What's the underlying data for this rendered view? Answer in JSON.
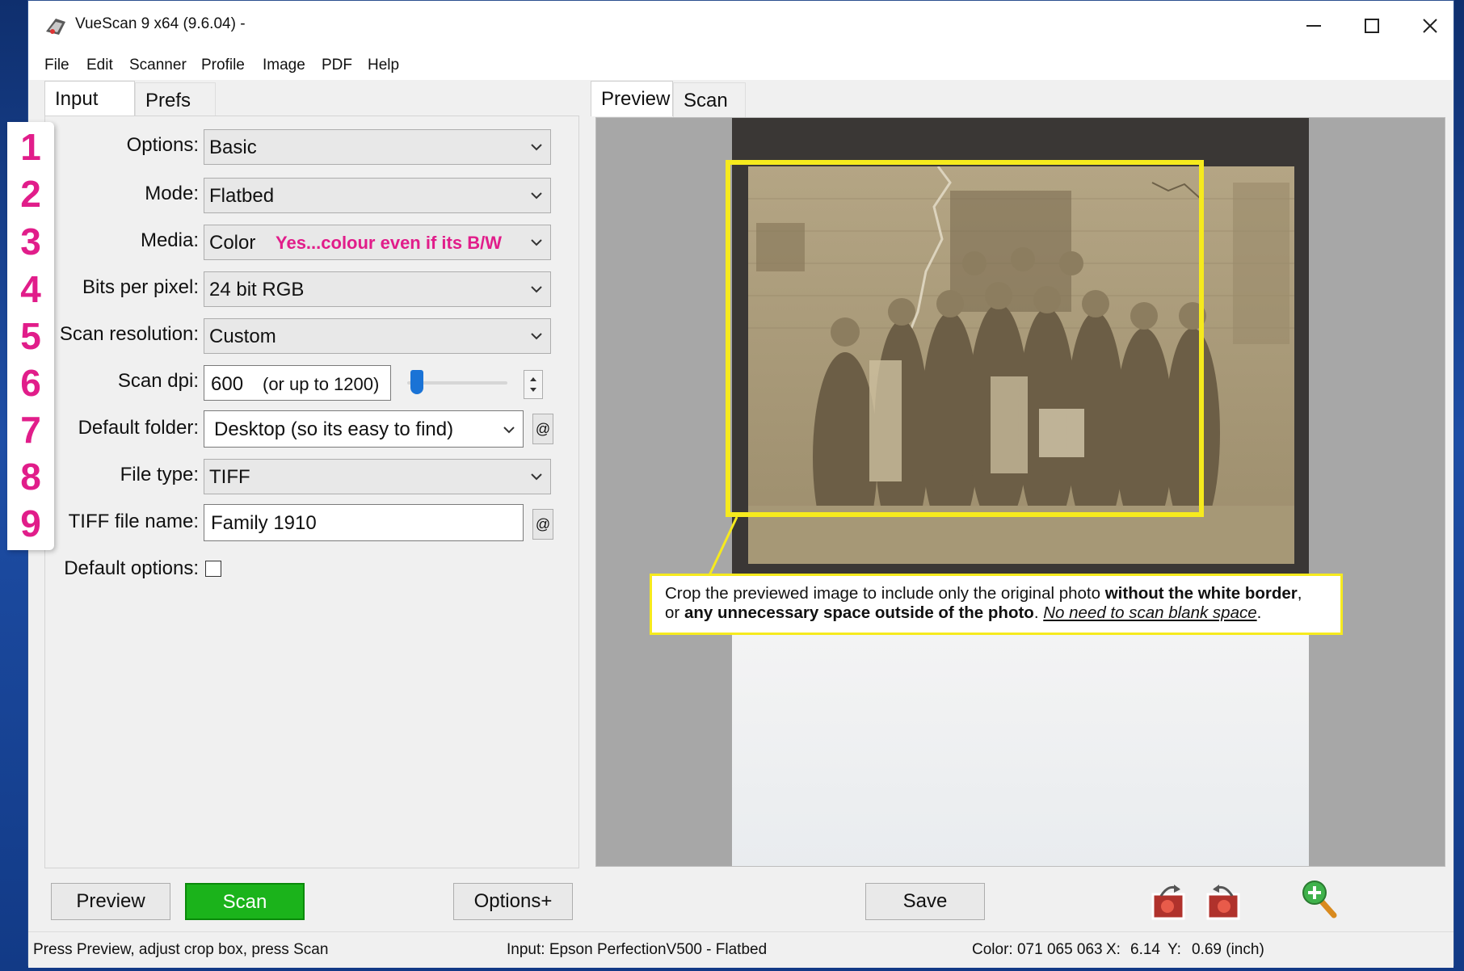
{
  "window": {
    "title": "VueScan 9 x64 (9.6.04) -",
    "controls": [
      "minimize",
      "maximize",
      "close"
    ]
  },
  "menu": [
    "File",
    "Edit",
    "Scanner",
    "Profile",
    "Image",
    "PDF",
    "Help"
  ],
  "left_tabs": [
    "Input",
    "Prefs"
  ],
  "right_tabs": [
    "Preview",
    "Scan"
  ],
  "steps": [
    "1",
    "2",
    "3",
    "4",
    "5",
    "6",
    "7",
    "8",
    "9"
  ],
  "fields": {
    "options": {
      "label": "Options:",
      "value": "Basic"
    },
    "mode": {
      "label": "Mode:",
      "value": "Flatbed"
    },
    "media": {
      "label": "Media:",
      "value": "Color",
      "note": "Yes...colour even if its B/W"
    },
    "bits": {
      "label": "Bits per pixel:",
      "value": "24 bit RGB"
    },
    "resolution": {
      "label": "Scan resolution:",
      "value": "Custom"
    },
    "dpi": {
      "label": "Scan dpi:",
      "value": "600",
      "hint": "(or up to 1200)"
    },
    "folder": {
      "label": "Default folder:",
      "value": "Desktop (so its easy to find)"
    },
    "filetype": {
      "label": "File type:",
      "value": "TIFF"
    },
    "filename": {
      "label": "TIFF file name:",
      "value": "Family 1910"
    },
    "default_options": {
      "label": "Default options:",
      "checked": false
    }
  },
  "at_symbol": "@",
  "callout": {
    "part1": "Crop the previewed image to include only the original photo ",
    "bold1": "without the white border",
    "part2": ",",
    "part3": "or ",
    "bold2": "any unnecessary space outside of the photo",
    "part4": ". ",
    "underlined": "No need to scan blank space",
    "part5": "."
  },
  "buttons": {
    "preview": "Preview",
    "scan": "Scan",
    "options_plus": "Options+",
    "save": "Save"
  },
  "icons": [
    "rotate-left-icon",
    "rotate-right-icon",
    "zoom-in-icon"
  ],
  "status": {
    "hint": "Press Preview, adjust crop box, press Scan",
    "input": "Input: Epson PerfectionV500 - Flatbed",
    "color": "Color: 071 065 063",
    "x_label": "X:",
    "x_value": "6.14",
    "y_label": "Y:",
    "y_value": "0.69 (inch)"
  },
  "colors": {
    "accent_pink": "#e11d8a",
    "crop_yellow": "#f6ea1d",
    "scan_green": "#1bb31b",
    "sepia": "#a99a79"
  }
}
